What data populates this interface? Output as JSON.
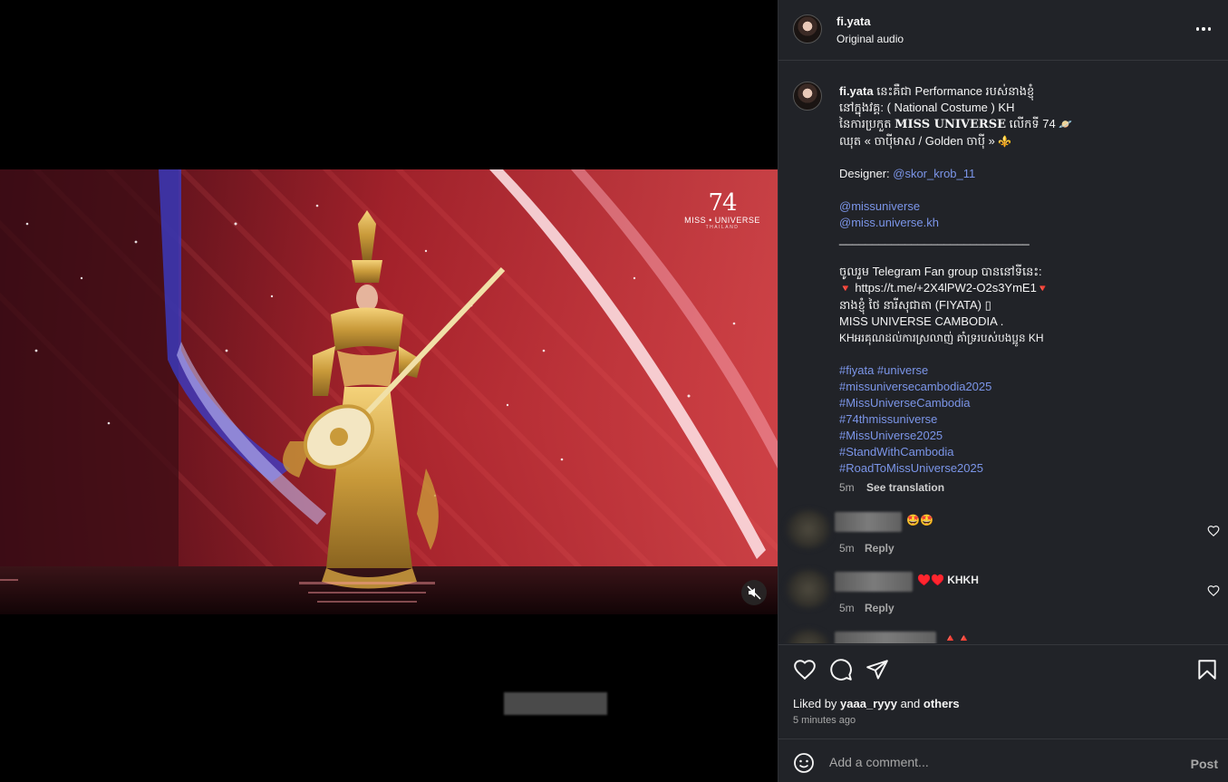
{
  "header": {
    "username": "fi.yata",
    "audio": "Original audio",
    "more_icon": "more-horizontal-icon"
  },
  "video": {
    "logo_number": "74",
    "logo_text": "MISS • UNIVERSE",
    "logo_sub": "THAILAND",
    "muted": true
  },
  "caption": {
    "username": "fi.yata",
    "l1": " នេះគឺជា Performance របស់នាងខ្ញុំ",
    "l2": "នៅក្នុងវគ្គ: ( National Costume ) KH",
    "l3_pre": "នៃការប្រកួត ",
    "l3_bold": "MISS UNIVERSE",
    "l3_post": " លើកទី 74 ",
    "l3_emoji": "🪐",
    "l4": "ឈុត « ចាប៉ីមាស / Golden ចាប៉ី » ",
    "l4_emoji": "⚜️",
    "designer_label": "Designer: ",
    "designer_handle": "@skor_krob_11",
    "mention1": "@missuniverse",
    "mention2": "@miss.universe.kh",
    "divider": "_____________________________",
    "l5": "ចូលរួម Telegram Fan group បាននៅទីនេះ:",
    "tri": "🔻",
    "telegram": "https://t.me/+2X4lPW2-O2s3YmE1",
    "l6": "នាងខ្ញុំ ថៃ នារីសុជាតា (FIYATA) ▯",
    "l7": "MISS UNIVERSE CAMBODIA .",
    "l8": "KHអរគុណដល់ការស្រលាញ់ គាំទ្ររបស់បងប្អូន KH",
    "tags": [
      "#fiyata #universe",
      "#missuniversecambodia2025",
      "#MissUniverseCambodia",
      "#74thmissuniverse",
      "#MissUniverse2025",
      "#StandWithCambodia",
      "#RoadToMissUniverse2025"
    ],
    "time": "5m",
    "see_translation": "See translation"
  },
  "comments": [
    {
      "text": "🤩🤩",
      "time": "5m",
      "reply": "Reply"
    },
    {
      "text": "♥️♥️ KHKH",
      "time": "5m",
      "reply": "Reply"
    },
    {
      "text": "🔺🔺",
      "time": "",
      "reply": ""
    }
  ],
  "actions": {
    "icons": [
      "heart-icon",
      "comment-icon",
      "share-icon",
      "bookmark-icon"
    ],
    "liked_by_prefix": "Liked by ",
    "liked_by_user": "yaaa_ryyy",
    "liked_by_and": " and ",
    "liked_by_others": "others",
    "time_ago": "5 minutes ago"
  },
  "compose": {
    "placeholder": "Add a comment...",
    "post_label": "Post"
  },
  "colors": {
    "panel_bg": "#212328",
    "link": "#7b95e8",
    "muted_text": "#a8a8a8"
  }
}
